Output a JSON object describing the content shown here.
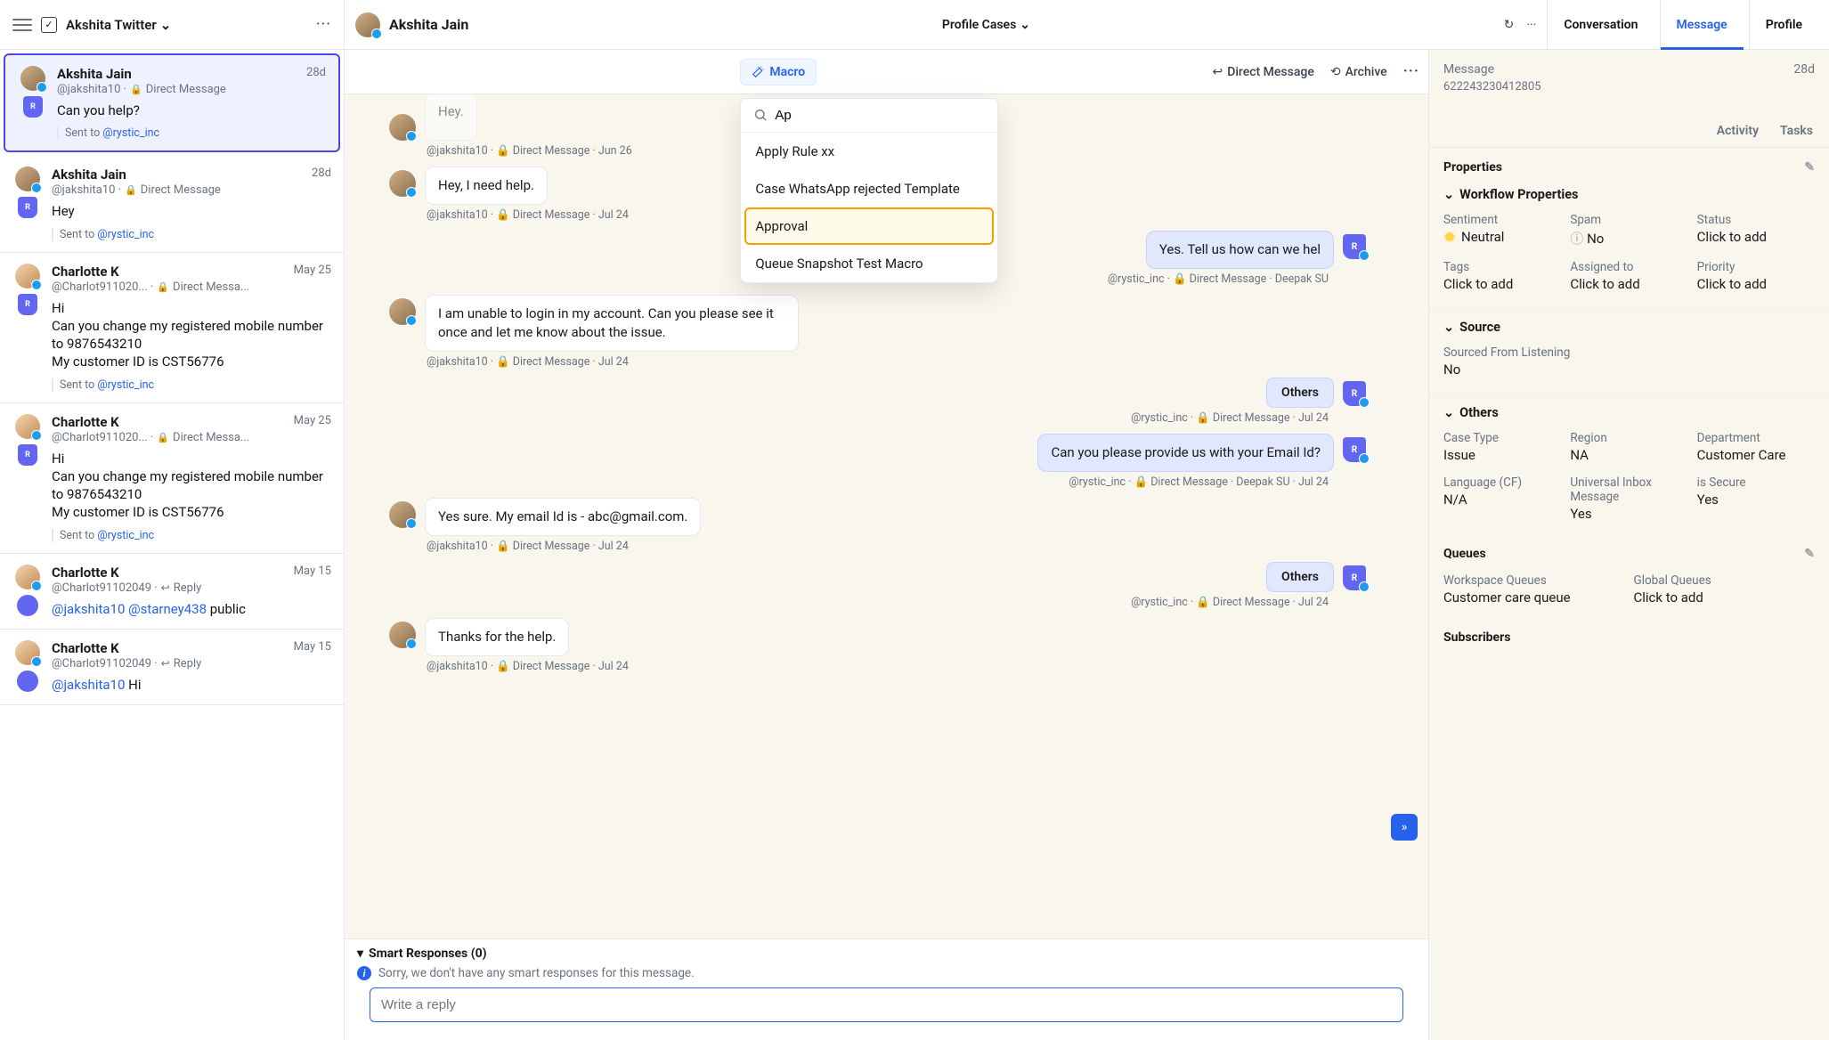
{
  "header": {
    "workspace": "Akshita Twitter",
    "profile_name": "Akshita Jain",
    "center_dropdown": "Profile Cases",
    "tabs": {
      "conversation": "Conversation",
      "message": "Message",
      "profile": "Profile"
    }
  },
  "subheader": {
    "macro": "Macro",
    "direct_message": "Direct Message",
    "archive": "Archive"
  },
  "macro_popup": {
    "search_value": "Ap",
    "items": [
      "Apply Rule xx",
      "Case WhatsApp rejected Template",
      "Approval",
      "Queue Snapshot Test Macro"
    ],
    "highlighted_index": 2
  },
  "cases": [
    {
      "name": "Akshita Jain",
      "handle": "@jakshita10",
      "type": "Direct Message",
      "date": "28d",
      "text": "Can you help?",
      "sent_to": "@rystic_inc",
      "selected": true,
      "shield": "R"
    },
    {
      "name": "Akshita Jain",
      "handle": "@jakshita10",
      "type": "Direct Message",
      "date": "28d",
      "text": "Hey",
      "sent_to": "@rystic_inc",
      "shield": "R"
    },
    {
      "name": "Charlotte K",
      "handle": "@Charlot911020...",
      "type": "Direct Messa...",
      "date": "May 25",
      "text": "Hi\nCan you change my registered mobile number to 9876543210\nMy customer ID is CST56776",
      "sent_to": "@rystic_inc",
      "shield": "R",
      "avatar": "c2"
    },
    {
      "name": "Charlotte K",
      "handle": "@Charlot911020...",
      "type": "Direct Messa...",
      "date": "May 25",
      "text": "Hi\nCan you change my registered mobile number to 9876543210\nMy customer ID is CST56776",
      "sent_to": "@rystic_inc",
      "shield": "R",
      "avatar": "c2"
    },
    {
      "name": "Charlotte K",
      "handle": "@Charlot91102049",
      "type": "Reply",
      "date": "May 15",
      "html": "<span class='mention'>@jakshita10</span> <span class='mention'>@starney438</span> public",
      "avatar": "c2",
      "reply": true,
      "double": true
    },
    {
      "name": "Charlotte K",
      "handle": "@Charlot91102049",
      "type": "Reply",
      "date": "May 15",
      "html": "<span class='mention'>@jakshita10</span> Hi",
      "avatar": "c2",
      "reply": true,
      "double": true
    }
  ],
  "conversation": [
    {
      "dir": "in",
      "text": "Hey.",
      "meta": "@jakshita10  ·  🔒 Direct Message  ·  Jun 26",
      "truncated": true
    },
    {
      "dir": "in",
      "text": "Hey, I need help.",
      "meta": "@jakshita10  ·  🔒 Direct Message  ·  Jul 24"
    },
    {
      "dir": "out",
      "text": "Yes. Tell us how can we hel",
      "meta": "@rystic_inc  ·  🔒 Direct Message  ·  Deepak SU",
      "cut": true
    },
    {
      "dir": "in",
      "text": "I am unable to login in my account. Can you please see it once and let me know about the issue.",
      "meta": "@jakshita10  ·  🔒 Direct Message  ·  Jul 24"
    },
    {
      "dir": "out",
      "tag": "Others",
      "meta": "@rystic_inc  ·  🔒 Direct Message  ·  Jul 24"
    },
    {
      "dir": "out",
      "text": "Can you please provide us with your Email Id?",
      "meta": "@rystic_inc  ·  🔒 Direct Message  ·  Deepak SU  ·  Jul 24"
    },
    {
      "dir": "in",
      "text": "Yes sure. My email Id is - abc@gmail.com.",
      "meta": "@jakshita10  ·  🔒 Direct Message  ·  Jul 24"
    },
    {
      "dir": "out",
      "tag": "Others",
      "meta": "@rystic_inc  ·  🔒 Direct Message  ·  Jul 24"
    },
    {
      "dir": "in",
      "text": "Thanks for the help.",
      "meta": "@jakshita10  ·  🔒 Direct Message  ·  Jul 24"
    }
  ],
  "responses": {
    "title": "Smart Responses (0)",
    "empty": "Sorry, we don't have any smart responses for this message."
  },
  "reply_placeholder": "Write a reply",
  "right": {
    "label": "Message",
    "date": "28d",
    "id": "622243230412805",
    "tabs": {
      "activity": "Activity",
      "tasks": "Tasks"
    },
    "properties_title": "Properties",
    "workflow_title": "Workflow Properties",
    "workflow": [
      {
        "l": "Sentiment",
        "v": "Neutral",
        "sent": true
      },
      {
        "l": "Spam",
        "v": "No",
        "info": true
      },
      {
        "l": "Status",
        "v": "Click to add"
      },
      {
        "l": "Tags",
        "v": "Click to add"
      },
      {
        "l": "Assigned to",
        "v": "Click to add"
      },
      {
        "l": "Priority",
        "v": "Click to add"
      }
    ],
    "source_title": "Source",
    "source": [
      {
        "l": "Sourced From Listening",
        "v": "No"
      }
    ],
    "others_title": "Others",
    "others": [
      {
        "l": "Case Type",
        "v": "Issue"
      },
      {
        "l": "Region",
        "v": "NA"
      },
      {
        "l": "Department",
        "v": "Customer Care"
      },
      {
        "l": "Language (CF)",
        "v": "N/A"
      },
      {
        "l": "Universal Inbox Message",
        "v": "Yes"
      },
      {
        "l": "is Secure",
        "v": "Yes"
      }
    ],
    "queues_title": "Queues",
    "queues": [
      {
        "l": "Workspace Queues",
        "v": "Customer care queue"
      },
      {
        "l": "Global Queues",
        "v": "Click to add"
      }
    ],
    "subscribers_title": "Subscribers"
  }
}
